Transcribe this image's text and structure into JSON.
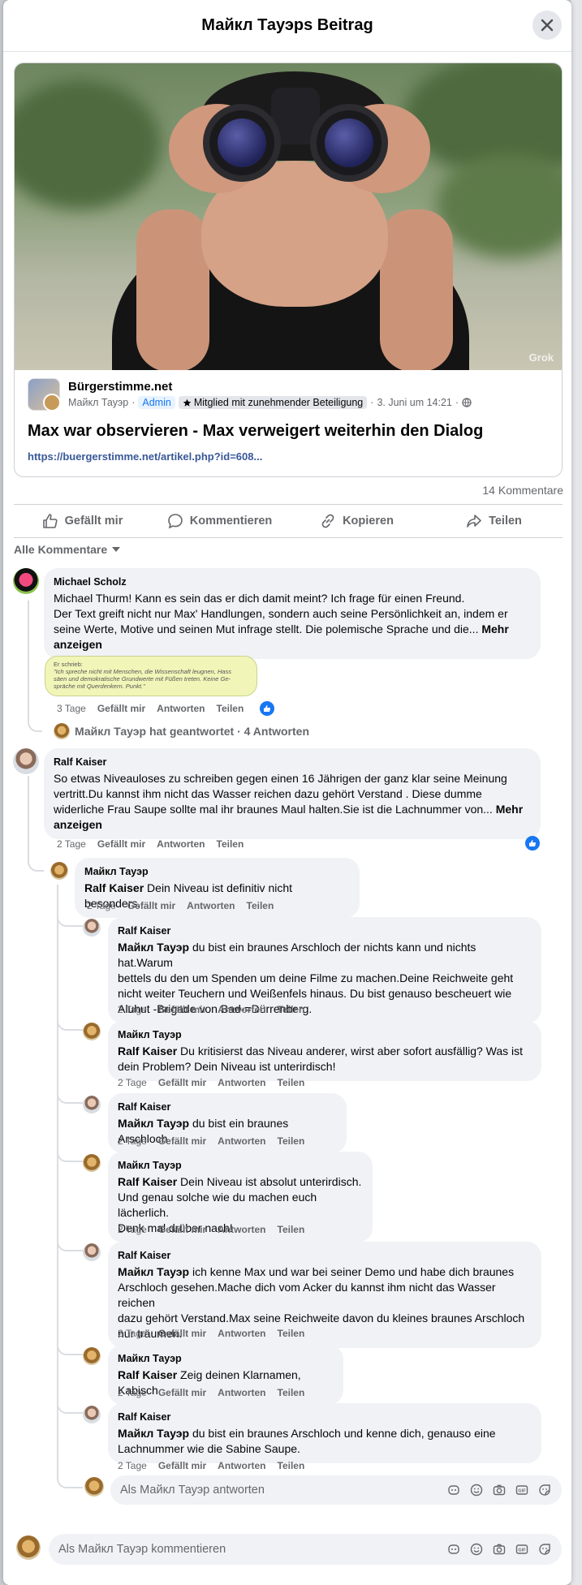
{
  "modal": {
    "title": "Майкл Тауэрs Beitrag"
  },
  "post": {
    "image_watermark": "Grok",
    "page_name": "Bürgerstimme.net",
    "author": "Майкл Тауэр",
    "role": "Admin",
    "badge": "Mitglied mit zunehmender Beteiligung",
    "date": "3. Juni um 14:21",
    "title": "Max war observieren - Max verweigert weiterhin den Dialog",
    "link": "https://buergerstimme.net/artikel.php?id=608..."
  },
  "stats": {
    "comments": "14 Kommentare"
  },
  "actions": {
    "like": "Gefällt mir",
    "comment": "Kommentieren",
    "copy": "Kopieren",
    "share": "Teilen"
  },
  "sort_label": "Alle Kommentare",
  "comment_actions": {
    "like": "Gefällt mir",
    "reply": "Antworten",
    "share": "Teilen",
    "more": "Mehr anzeigen"
  },
  "comments": [
    {
      "author": "Michael Scholz",
      "lines": [
        "Michael Thurm! Kann es sein das er dich damit meint? Ich frage für einen Freund.",
        "Der Text greift nicht nur Max' Handlungen, sondern auch seine Persönlichkeit an, indem er",
        "seine Werte, Motive und seinen Mut infrage stellt. Die polemische Sprache und die..."
      ],
      "sticker_head": "Er schrieb:",
      "sticker_lines": [
        "\"Ich spreche nicht mit Menschen, die Wissenschaft leugnen, Hass",
        "säen und demokratische Grundwerte mit Füßen treten. Keine Ge-",
        "spräche mit Querdenkern. Punkt.\""
      ],
      "time": "3 Tage",
      "replied": "Майкл Тауэр hat geantwortet · 4 Antworten"
    },
    {
      "author": "Ralf Kaiser",
      "lines": [
        "So etwas Niveauloses zu schreiben gegen einen 16 Jährigen der ganz klar seine Meinung",
        "vertritt.Du kannst ihm nicht das Wasser reichen dazu gehört Verstand . Diese dumme",
        "widerliche Frau Saupe sollte mal ihr braunes Maul halten.Sie ist die Lachnummer von..."
      ],
      "time": "2 Tage"
    }
  ],
  "replies": [
    {
      "author": "Майкл Тауэр",
      "mention": "Ralf Kaiser",
      "lines": [
        "Dein Niveau ist definitiv nicht besonders."
      ],
      "time": "2 Tage"
    },
    {
      "author": "Ralf Kaiser",
      "mention": "Майкл Тауэр",
      "lines": [
        "du bist ein braunes Arschloch der nichts kann und nichts hat.Warum",
        "bettels du den um Spenden um deine Filme zu machen.Deine Reichweite geht",
        "nicht weiter Teuchern und Weißenfels hinaus. Du bist genauso bescheuert wie",
        "Aluhut -Brigade von Bad-=Dürrenberg."
      ],
      "time": "2 Tage"
    },
    {
      "author": "Майкл Тауэр",
      "mention": "Ralf Kaiser",
      "lines": [
        "Du kritisierst das Niveau anderer, wirst aber sofort ausfällig? Was ist",
        "dein Problem? Dein Niveau ist unterirdisch!"
      ],
      "time": "2 Tage"
    },
    {
      "author": "Ralf Kaiser",
      "mention": "Майкл Тауэр",
      "lines": [
        "du bist ein braunes Arschloch"
      ],
      "time": "2 Tage"
    },
    {
      "author": "Майкл Тауэр",
      "mention": "Ralf Kaiser",
      "lines": [
        "Dein Niveau ist absolut unterirdisch.",
        "Und genau solche wie du machen euch lächerlich.",
        "Denk mal drüber nach!"
      ],
      "time": "2 Tage"
    },
    {
      "author": "Ralf Kaiser",
      "mention": "Майкл Тауэр",
      "lines": [
        "ich kenne Max und war bei seiner Demo und habe dich braunes",
        "Arschloch gesehen.Mache dich vom Acker du kannst ihm nicht das Wasser reichen",
        "dazu gehört Verstand.Max seine Reichweite davon du kleines braunes Arschloch",
        "nur träumen."
      ],
      "time": "2 Tage"
    },
    {
      "author": "Майкл Тауэр",
      "mention": "Ralf Kaiser",
      "lines": [
        "Zeig deinen Klarnamen, Kabisch."
      ],
      "time": "2 Tage"
    },
    {
      "author": "Ralf Kaiser",
      "mention": "Майкл Тауэр",
      "lines": [
        "du bist ein braunes Arschloch und kenne dich, genauso eine",
        "Lachnummer wie die Sabine Saupe."
      ],
      "time": "2 Tage"
    }
  ],
  "reply_input_placeholder": "Als Майкл Тауэр antworten",
  "comment_input_placeholder": "Als Майкл Тауэр kommentieren",
  "colors": {
    "accent": "#1877f2",
    "bubble": "#f0f2f5",
    "muted": "#65676b"
  }
}
